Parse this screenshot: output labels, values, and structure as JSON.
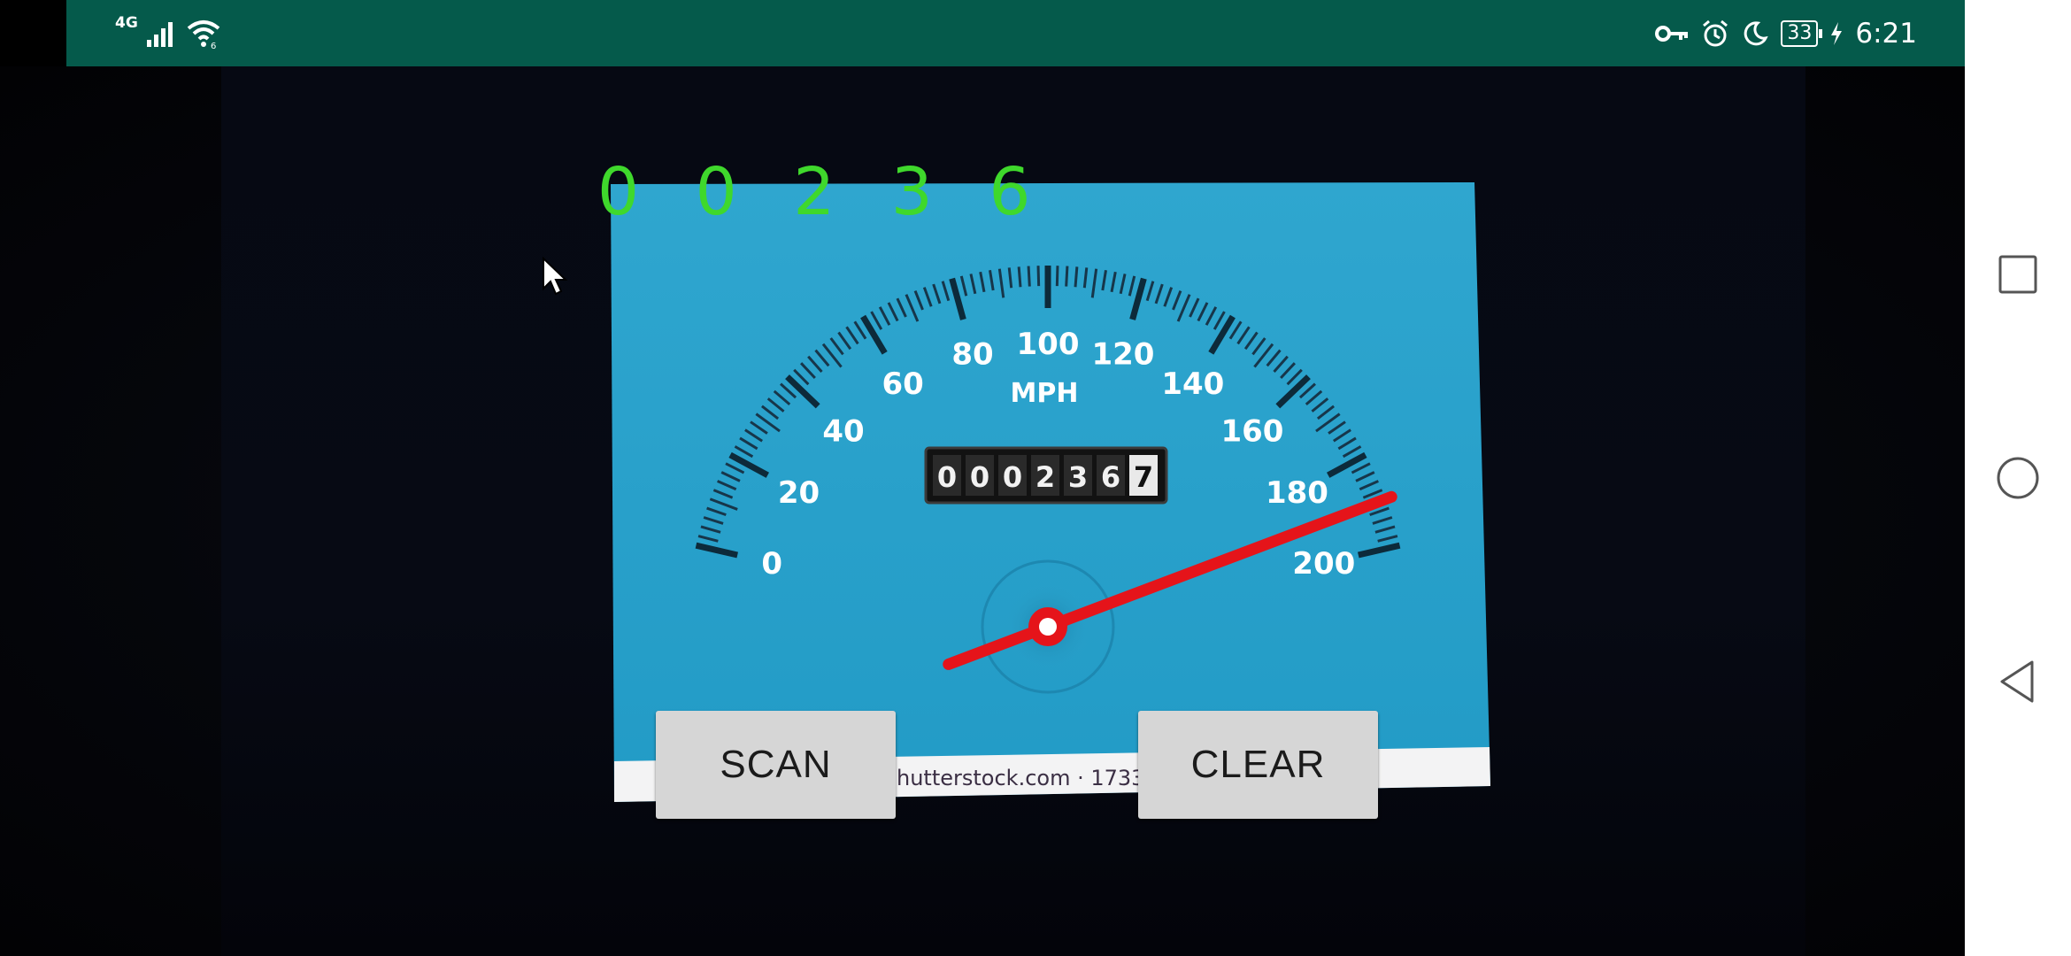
{
  "status_bar": {
    "network_type": "4G",
    "wifi_badge": "6",
    "battery_level": "33",
    "time": "6:21",
    "icons": [
      "signal-icon",
      "wifi-icon",
      "vpn-key-icon",
      "alarm-icon",
      "do-not-disturb-moon-icon",
      "battery-icon",
      "charging-bolt-icon"
    ]
  },
  "ocr_result": "0 0 2 3 6",
  "photo": {
    "unit_label": "MPH",
    "dial_ticks": [
      "0",
      "20",
      "40",
      "60",
      "80",
      "100",
      "120",
      "140",
      "160",
      "180",
      "200"
    ],
    "odometer_digits": [
      "0",
      "0",
      "0",
      "2",
      "3",
      "6"
    ],
    "odometer_tenths": "7",
    "watermark_text": "hutterstock.com · 1733",
    "needle_value_mph": 190
  },
  "buttons": {
    "scan_label": "SCAN",
    "clear_label": "CLEAR"
  },
  "nav_bar": {
    "icons": [
      "recents-square-icon",
      "home-circle-icon",
      "back-triangle-icon"
    ]
  },
  "colors": {
    "status_bar": "#055a4b",
    "ocr_text": "#3fd82c",
    "dial_face": "#2aa0c9",
    "needle": "#e5141a",
    "button": "#d6d6d6"
  }
}
